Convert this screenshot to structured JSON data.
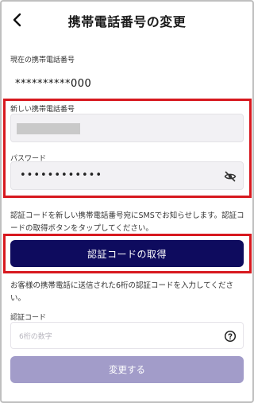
{
  "header": {
    "title": "携帯電話番号の変更",
    "back_icon": "chevron-left-icon"
  },
  "current": {
    "label": "現在の携帯電話番号",
    "value": "**********000"
  },
  "new_phone": {
    "label": "新しい携帯電話番号"
  },
  "password": {
    "label": "パスワード",
    "value": "••••••••••••",
    "toggle_icon": "eye-off-icon"
  },
  "info": {
    "text": "認証コードを新しい携帯電話番号宛にSMSでお知らせします。認証コードの取得ボタンをタップしてください。"
  },
  "get_code_button": {
    "label": "認証コードの取得",
    "color": "#0e0b5e"
  },
  "instruction": {
    "text": "お客様の携帯電話に送信された6桁の認証コードを入力してください。"
  },
  "code": {
    "label": "認証コード",
    "placeholder": "6桁の数字",
    "help_icon": "question-circle-icon"
  },
  "submit_button": {
    "label": "変更する",
    "color": "#a29cc9"
  },
  "highlight_color": "#d7191f"
}
